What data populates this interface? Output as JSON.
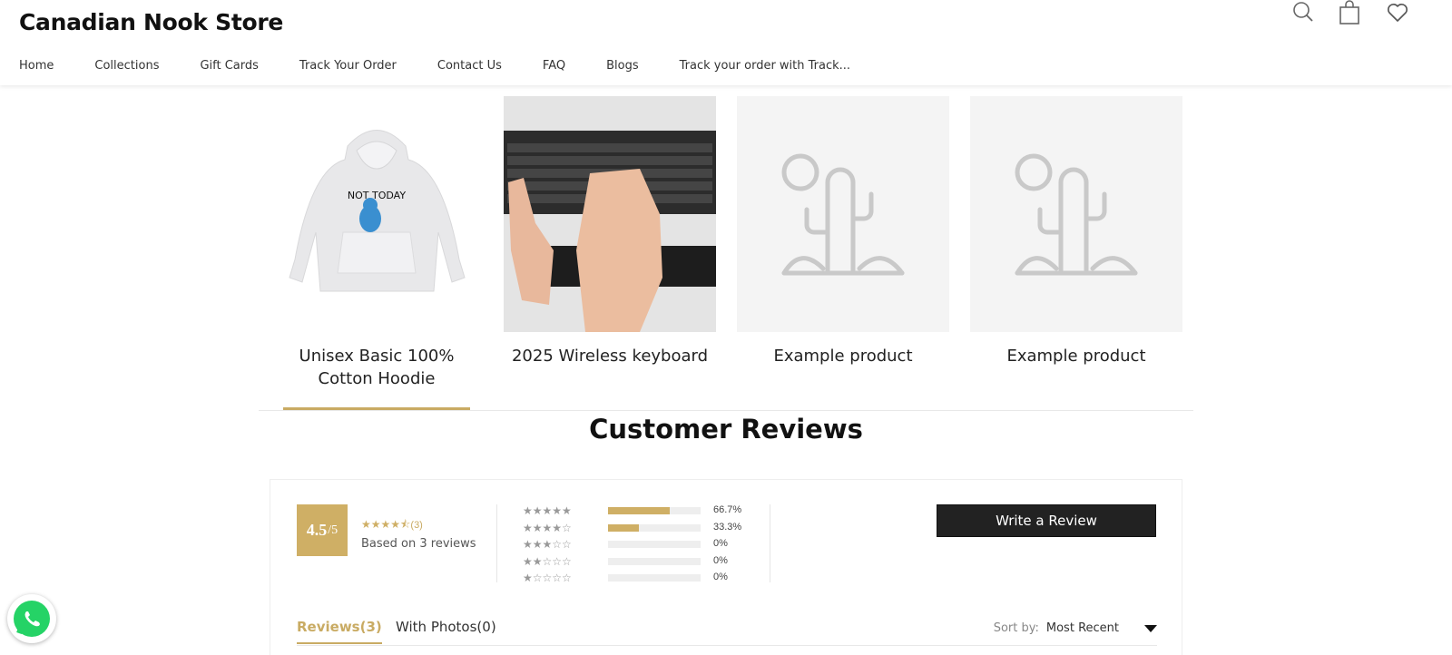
{
  "header": {
    "logo": "Canadian Nook Store",
    "nav": [
      "Home",
      "Collections",
      "Gift Cards",
      "Track Your Order",
      "Contact Us",
      "FAQ",
      "Blogs",
      "Track your order with Track..."
    ]
  },
  "products": [
    {
      "title": "Unisex Basic 100% Cotton Hoodie",
      "image": "hoodie"
    },
    {
      "title": "2025 Wireless keyboard",
      "image": "keyboard"
    },
    {
      "title": "Example product",
      "image": "placeholder"
    },
    {
      "title": "Example product",
      "image": "placeholder"
    }
  ],
  "reviews": {
    "title": "Customer Reviews",
    "score": "4.5",
    "score_max": "/5",
    "stars": "★★★★⯪",
    "count": "(3)",
    "based_on": "Based on 3 reviews",
    "distribution": [
      {
        "stars": "★★★★★",
        "fraction": 0.667,
        "label": "66.7%"
      },
      {
        "stars": "★★★★☆",
        "fraction": 0.333,
        "label": "33.3%"
      },
      {
        "stars": "★★★☆☆",
        "fraction": 0,
        "label": "0%"
      },
      {
        "stars": "★★☆☆☆",
        "fraction": 0,
        "label": "0%"
      },
      {
        "stars": "★☆☆☆☆",
        "fraction": 0,
        "label": "0%"
      }
    ],
    "write_button": "Write a Review",
    "tabs": [
      "Reviews(3)",
      "With Photos(0)"
    ],
    "sort_label": "Sort by:",
    "sort_value": "Most Recent"
  },
  "colors": {
    "accent": "#cfaf65",
    "button": "#222222"
  }
}
